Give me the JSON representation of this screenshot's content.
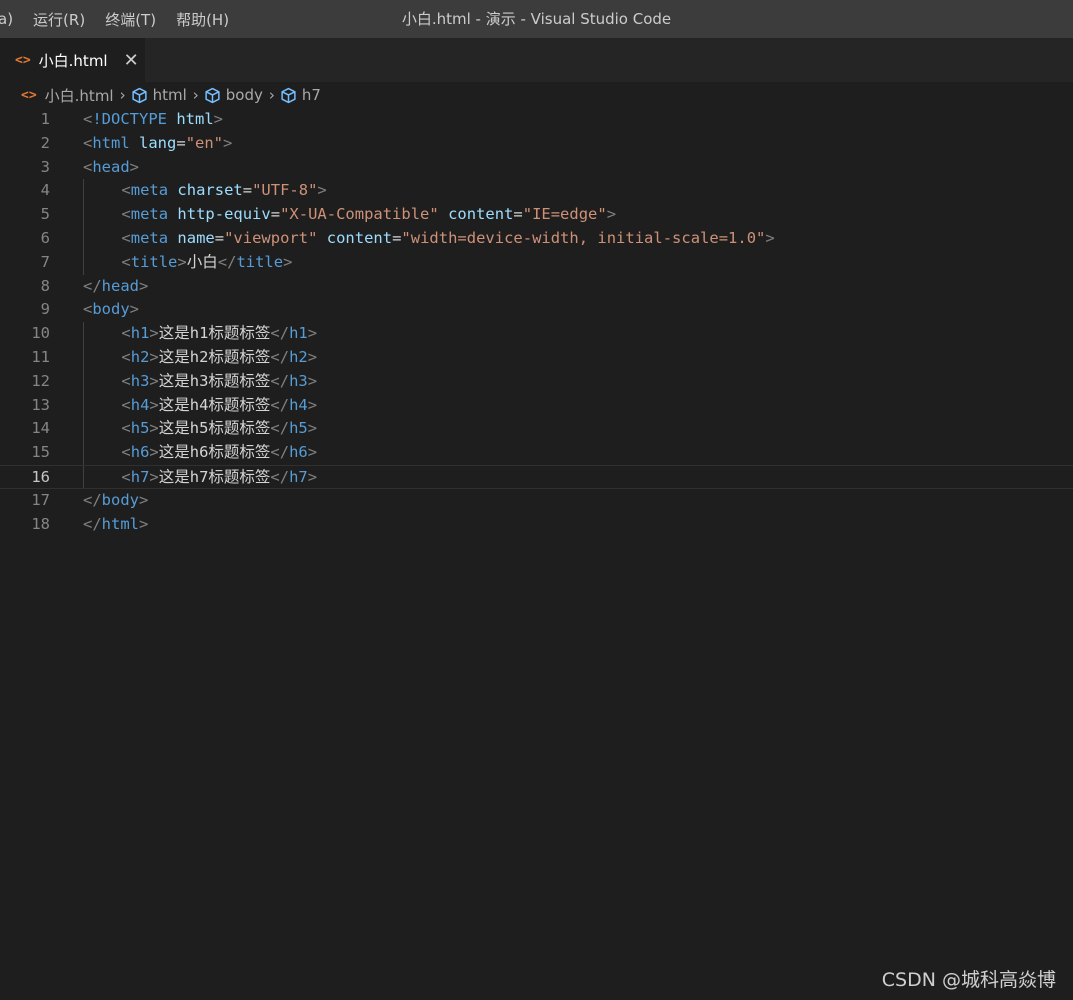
{
  "titlebar": {
    "menu": [
      "a)",
      "运行(R)",
      "终端(T)",
      "帮助(H)"
    ],
    "window_title": "小白.html - 演示 - Visual Studio Code"
  },
  "tab": {
    "icon": "<>",
    "label": "小白.html",
    "close": "✕"
  },
  "breadcrumb": {
    "file": "小白.html",
    "items": [
      "html",
      "body",
      "h7"
    ]
  },
  "editor": {
    "current_line": 16,
    "lines": [
      {
        "n": "1",
        "indent": 0,
        "tokens": [
          [
            "punct",
            "<"
          ],
          [
            "tag",
            "!DOCTYPE"
          ],
          [
            "plain",
            " "
          ],
          [
            "attr",
            "html"
          ],
          [
            "punct",
            ">"
          ]
        ]
      },
      {
        "n": "2",
        "indent": 0,
        "tokens": [
          [
            "punct",
            "<"
          ],
          [
            "tag",
            "html"
          ],
          [
            "plain",
            " "
          ],
          [
            "attr",
            "lang"
          ],
          [
            "plain",
            "="
          ],
          [
            "str",
            "\"en\""
          ],
          [
            "punct",
            ">"
          ]
        ]
      },
      {
        "n": "3",
        "indent": 0,
        "tokens": [
          [
            "punct",
            "<"
          ],
          [
            "tag",
            "head"
          ],
          [
            "punct",
            ">"
          ]
        ]
      },
      {
        "n": "4",
        "indent": 1,
        "tokens": [
          [
            "punct",
            "<"
          ],
          [
            "tag",
            "meta"
          ],
          [
            "plain",
            " "
          ],
          [
            "attr",
            "charset"
          ],
          [
            "plain",
            "="
          ],
          [
            "str",
            "\"UTF-8\""
          ],
          [
            "punct",
            ">"
          ]
        ]
      },
      {
        "n": "5",
        "indent": 1,
        "tokens": [
          [
            "punct",
            "<"
          ],
          [
            "tag",
            "meta"
          ],
          [
            "plain",
            " "
          ],
          [
            "attr",
            "http-equiv"
          ],
          [
            "plain",
            "="
          ],
          [
            "str",
            "\"X-UA-Compatible\""
          ],
          [
            "plain",
            " "
          ],
          [
            "attr",
            "content"
          ],
          [
            "plain",
            "="
          ],
          [
            "str",
            "\"IE=edge\""
          ],
          [
            "punct",
            ">"
          ]
        ]
      },
      {
        "n": "6",
        "indent": 1,
        "tokens": [
          [
            "punct",
            "<"
          ],
          [
            "tag",
            "meta"
          ],
          [
            "plain",
            " "
          ],
          [
            "attr",
            "name"
          ],
          [
            "plain",
            "="
          ],
          [
            "str",
            "\"viewport\""
          ],
          [
            "plain",
            " "
          ],
          [
            "attr",
            "content"
          ],
          [
            "plain",
            "="
          ],
          [
            "str",
            "\"width=device-width, initial-scale=1.0\""
          ],
          [
            "punct",
            ">"
          ]
        ]
      },
      {
        "n": "7",
        "indent": 1,
        "tokens": [
          [
            "punct",
            "<"
          ],
          [
            "tag",
            "title"
          ],
          [
            "punct",
            ">"
          ],
          [
            "text",
            "小白"
          ],
          [
            "punct",
            "</"
          ],
          [
            "tag",
            "title"
          ],
          [
            "punct",
            ">"
          ]
        ]
      },
      {
        "n": "8",
        "indent": 0,
        "tokens": [
          [
            "punct",
            "</"
          ],
          [
            "tag",
            "head"
          ],
          [
            "punct",
            ">"
          ]
        ]
      },
      {
        "n": "9",
        "indent": 0,
        "tokens": [
          [
            "punct",
            "<"
          ],
          [
            "tag",
            "body"
          ],
          [
            "punct",
            ">"
          ]
        ]
      },
      {
        "n": "10",
        "indent": 1,
        "tokens": [
          [
            "punct",
            "<"
          ],
          [
            "tag",
            "h1"
          ],
          [
            "punct",
            ">"
          ],
          [
            "text",
            "这是h1标题标签"
          ],
          [
            "punct",
            "</"
          ],
          [
            "tag",
            "h1"
          ],
          [
            "punct",
            ">"
          ]
        ]
      },
      {
        "n": "11",
        "indent": 1,
        "tokens": [
          [
            "punct",
            "<"
          ],
          [
            "tag",
            "h2"
          ],
          [
            "punct",
            ">"
          ],
          [
            "text",
            "这是h2标题标签"
          ],
          [
            "punct",
            "</"
          ],
          [
            "tag",
            "h2"
          ],
          [
            "punct",
            ">"
          ]
        ]
      },
      {
        "n": "12",
        "indent": 1,
        "tokens": [
          [
            "punct",
            "<"
          ],
          [
            "tag",
            "h3"
          ],
          [
            "punct",
            ">"
          ],
          [
            "text",
            "这是h3标题标签"
          ],
          [
            "punct",
            "</"
          ],
          [
            "tag",
            "h3"
          ],
          [
            "punct",
            ">"
          ]
        ]
      },
      {
        "n": "13",
        "indent": 1,
        "tokens": [
          [
            "punct",
            "<"
          ],
          [
            "tag",
            "h4"
          ],
          [
            "punct",
            ">"
          ],
          [
            "text",
            "这是h4标题标签"
          ],
          [
            "punct",
            "</"
          ],
          [
            "tag",
            "h4"
          ],
          [
            "punct",
            ">"
          ]
        ]
      },
      {
        "n": "14",
        "indent": 1,
        "tokens": [
          [
            "punct",
            "<"
          ],
          [
            "tag",
            "h5"
          ],
          [
            "punct",
            ">"
          ],
          [
            "text",
            "这是h5标题标签"
          ],
          [
            "punct",
            "</"
          ],
          [
            "tag",
            "h5"
          ],
          [
            "punct",
            ">"
          ]
        ]
      },
      {
        "n": "15",
        "indent": 1,
        "tokens": [
          [
            "punct",
            "<"
          ],
          [
            "tag",
            "h6"
          ],
          [
            "punct",
            ">"
          ],
          [
            "text",
            "这是h6标题标签"
          ],
          [
            "punct",
            "</"
          ],
          [
            "tag",
            "h6"
          ],
          [
            "punct",
            ">"
          ]
        ]
      },
      {
        "n": "16",
        "indent": 1,
        "tokens": [
          [
            "punct",
            "<"
          ],
          [
            "tag",
            "h7"
          ],
          [
            "punct",
            ">"
          ],
          [
            "text",
            "这是h7标题标签"
          ],
          [
            "punct",
            "</"
          ],
          [
            "tag",
            "h7"
          ],
          [
            "punct",
            ">"
          ]
        ]
      },
      {
        "n": "17",
        "indent": 0,
        "tokens": [
          [
            "punct",
            "</"
          ],
          [
            "tag",
            "body"
          ],
          [
            "punct",
            ">"
          ]
        ]
      },
      {
        "n": "18",
        "indent": 0,
        "tokens": [
          [
            "punct",
            "</"
          ],
          [
            "tag",
            "html"
          ],
          [
            "punct",
            ">"
          ]
        ]
      }
    ]
  },
  "watermark": "CSDN @城科高焱博"
}
